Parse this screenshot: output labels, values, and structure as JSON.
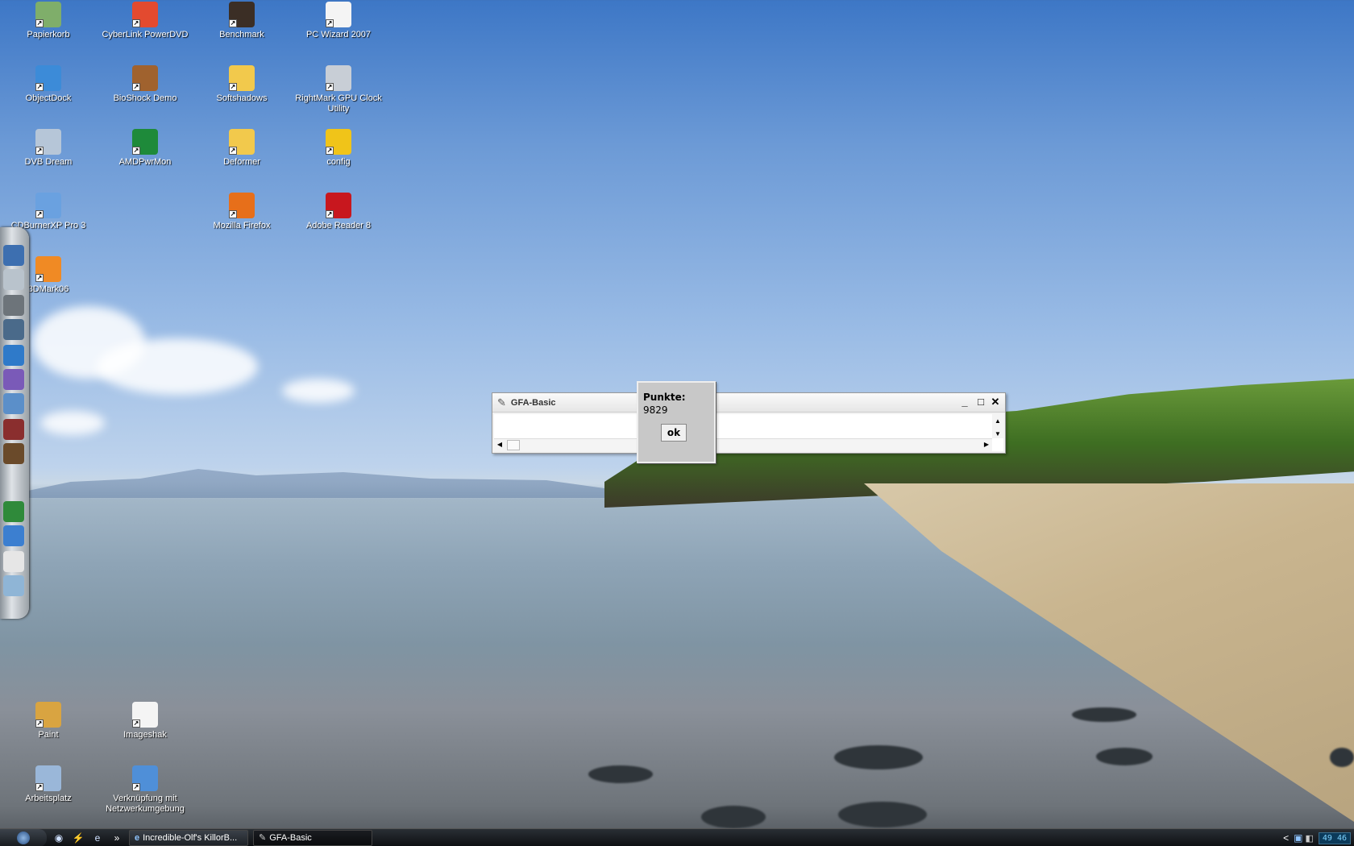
{
  "desktop": {
    "icons_top": [
      {
        "label": "Papierkorb",
        "icon": "recycle-bin-icon",
        "color": "#7fae6a"
      },
      {
        "label": "CyberLink PowerDVD",
        "icon": "powerdvd-icon",
        "color": "#e34a2f"
      },
      {
        "label": "Benchmark",
        "icon": "benchmark-icon",
        "color": "#3b2e25"
      },
      {
        "label": "PC Wizard 2007",
        "icon": "pc-wizard-icon",
        "color": "#f4f4f4"
      },
      {
        "label": "ObjectDock",
        "icon": "objectdock-icon",
        "color": "#3c8bd8"
      },
      {
        "label": "BioShock Demo",
        "icon": "bioshock-icon",
        "color": "#a0622e"
      },
      {
        "label": "Softshadows",
        "icon": "folder-icon",
        "color": "#f2c94c"
      },
      {
        "label": "RightMark GPU Clock Utility",
        "icon": "gear-icon",
        "color": "#c8ced6"
      },
      {
        "label": "DVB Dream",
        "icon": "dvb-dream-icon",
        "color": "#b6c6d8"
      },
      {
        "label": "AMDPwrMon",
        "icon": "amd-icon",
        "color": "#1e8a3a"
      },
      {
        "label": "Deformer",
        "icon": "folder-icon",
        "color": "#f2c94c"
      },
      {
        "label": "config",
        "icon": "config-icon",
        "color": "#f0c419"
      },
      {
        "label": "CDBurnerXP Pro 3",
        "icon": "cdburner-icon",
        "color": "#6aa1e0"
      },
      {
        "label": "Mozilla Firefox",
        "icon": "firefox-icon",
        "color": "#e76f1a"
      },
      {
        "label": "Adobe Reader 8",
        "icon": "adobe-reader-icon",
        "color": "#c8171e"
      },
      {
        "label": "3DMark06",
        "icon": "3dmark-icon",
        "color": "#f08a24"
      }
    ],
    "icons_bottom": [
      {
        "label": "Paint",
        "icon": "paint-icon",
        "color": "#d9a441"
      },
      {
        "label": "Imageshak",
        "icon": "document-icon",
        "color": "#f4f4f4"
      },
      {
        "label": "Arbeitsplatz",
        "icon": "computer-icon",
        "color": "#9ab7d9"
      },
      {
        "label": "Verknüpfung mit Netzwerkumgebung",
        "icon": "network-icon",
        "color": "#4f8fd8"
      }
    ]
  },
  "window": {
    "title": "GFA-Basic",
    "icon": "gfa-basic-icon",
    "controls": {
      "minimize": "_",
      "maximize": "□",
      "close": "✕"
    }
  },
  "message_box": {
    "label": "Punkte:",
    "value": "9829",
    "ok_label": "ok"
  },
  "taskbar": {
    "quick_launch": [
      "show-desktop-icon",
      "switch-windows-icon",
      "internet-explorer-icon"
    ],
    "overflow": "»",
    "buttons": [
      {
        "label": "Incredible-Olf's KillorB...",
        "icon": "internet-explorer-icon",
        "active": false
      },
      {
        "label": "GFA-Basic",
        "icon": "gfa-basic-icon",
        "active": true
      }
    ],
    "tray_arrow": "<",
    "clock": "49 46"
  }
}
